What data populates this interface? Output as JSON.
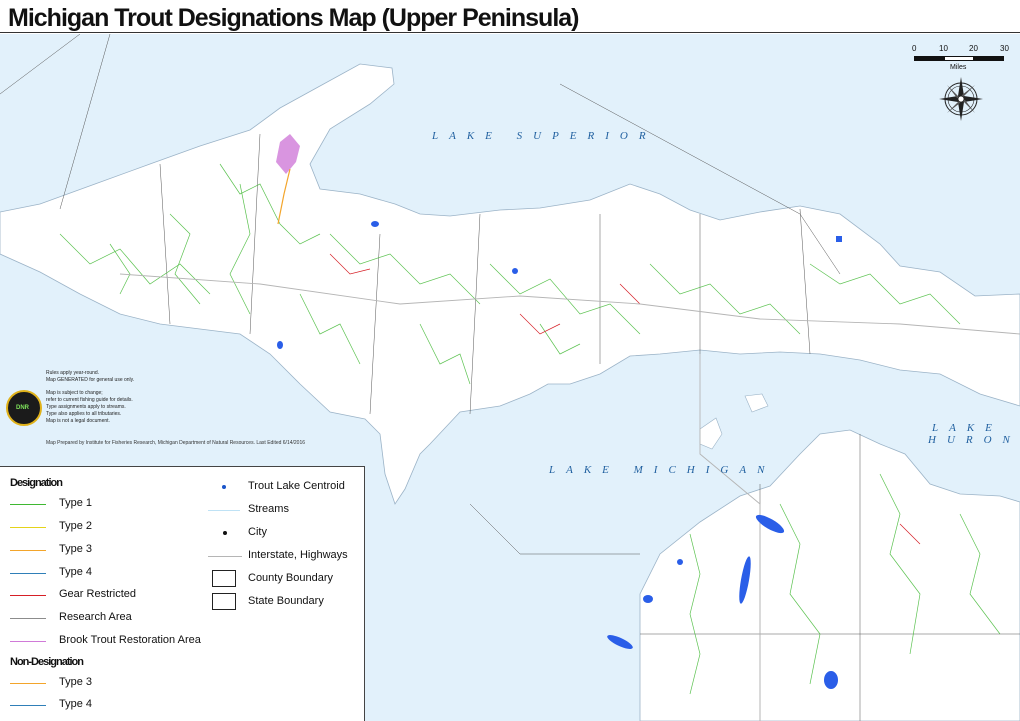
{
  "title": "Michigan Trout Designations Map (Upper Peninsula)",
  "lake_labels": {
    "superior": "LAKE SUPERIOR",
    "michigan": "LAKE MICHIGAN",
    "huron_1": "LAKE",
    "huron_2": "HURON"
  },
  "scale": {
    "ticks": [
      "0",
      "10",
      "20",
      "30"
    ],
    "unit": "Miles"
  },
  "notes": {
    "line1": "Rules apply year-round.",
    "line2": "Map GENERATED for general use only.",
    "line3": "Map is subject to change;",
    "line4": "refer to current fishing guide for details.",
    "line5": "Type assignments apply to streams.",
    "line6": "Type also applies to all tributaries.",
    "line7": "Map is not a legal document."
  },
  "logo_text": "DNR",
  "credit": "Map Prepared by Institute for Fisheries Research, Michigan Department of Natural Resources. Last Edited 6/14/2016",
  "legend": {
    "designation_heading": "Designation",
    "designation_items": [
      {
        "label": "Type 1",
        "color": "#3fb832"
      },
      {
        "label": "Type 2",
        "color": "#e4d31a"
      },
      {
        "label": "Type 3",
        "color": "#f3a52b"
      },
      {
        "label": "Type 4",
        "color": "#2f7fb8"
      },
      {
        "label": "Gear Restricted",
        "color": "#d61f26"
      },
      {
        "label": "Research Area",
        "color": "#8c8c8c"
      },
      {
        "label": "Brook Trout Restoration Area",
        "color": "#d07ad8"
      }
    ],
    "non_designation_heading": "Non-Designation",
    "non_designation_items": [
      {
        "label": "Type 3",
        "color": "#f3a52b"
      },
      {
        "label": "Type 4",
        "color": "#2f7fb8"
      }
    ],
    "other_items": [
      {
        "label": "Trout Lake Centroid",
        "symbol": "centroid-dot",
        "color": "#1a55c9"
      },
      {
        "label": "Streams",
        "symbol": "stream-line",
        "color": "#bfe2f5"
      },
      {
        "label": "City",
        "symbol": "city-dot",
        "color": "#111111"
      },
      {
        "label": "Interstate, Highways",
        "symbol": "highway-line",
        "color": "#b5b5b5"
      },
      {
        "label": "County Boundary",
        "symbol": "county-box",
        "color": "#222222"
      },
      {
        "label": "State Boundary",
        "symbol": "state-box",
        "color": "#222222"
      }
    ]
  },
  "colors": {
    "water": "#e2f1fb",
    "land": "#ffffff",
    "lake_fill": "#2a5ee8"
  }
}
